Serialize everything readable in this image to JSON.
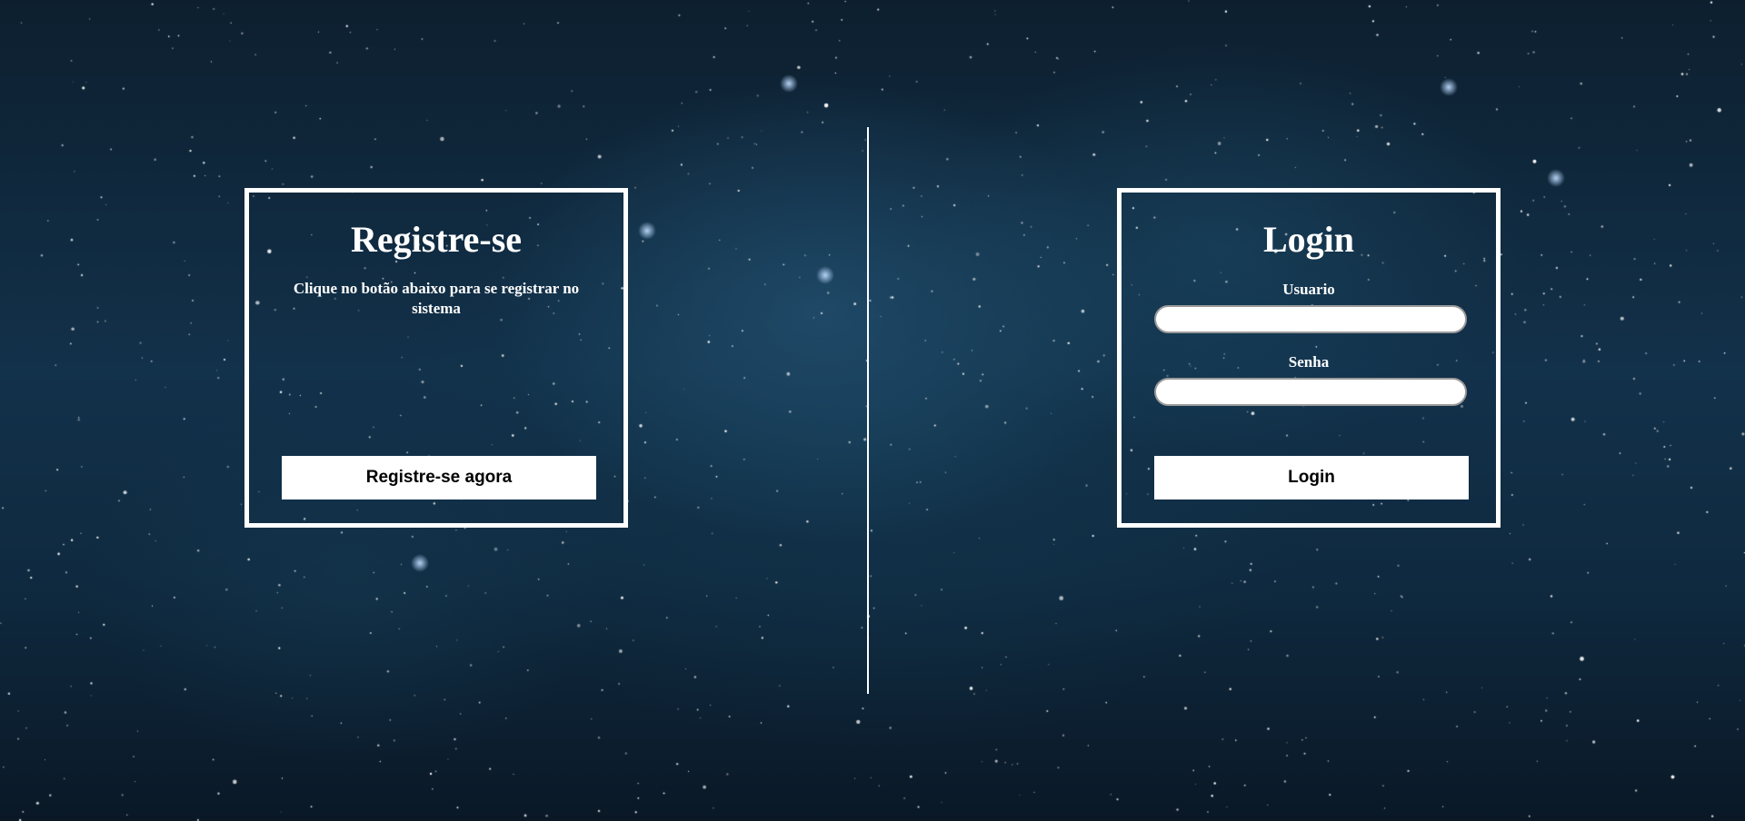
{
  "register": {
    "title": "Registre-se",
    "description": "Clique no botão abaixo para se registrar no sistema",
    "button_label": "Registre-se agora"
  },
  "login": {
    "title": "Login",
    "username_label": "Usuario",
    "username_value": "",
    "password_label": "Senha",
    "password_value": "",
    "button_label": "Login"
  },
  "colors": {
    "background": "#0f2a40",
    "panel_border": "#ffffff",
    "button_background": "#ffffff",
    "button_text": "#000000"
  }
}
